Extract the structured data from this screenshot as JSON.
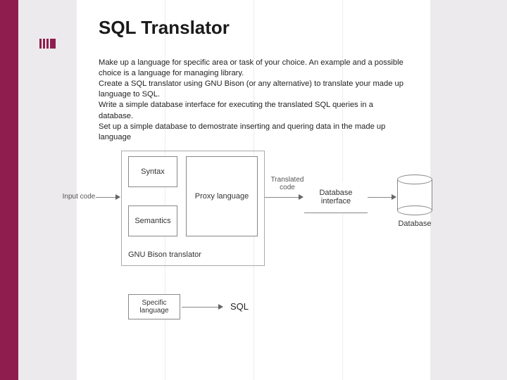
{
  "title": "SQL Translator",
  "paragraphs": [
    "Make up a language for specific area or task of your choice. An example and a possible choice is a language for managing library.",
    "Create a SQL translator using GNU Bison (or any alternative) to translate your made up language to SQL.",
    "Write a simple database interface  for executing the translated SQL queries in a database.",
    "Set up a simple database to demostrate inserting and quering data in the made up language"
  ],
  "diagram": {
    "input_label": "Input code",
    "syntax": "Syntax",
    "semantics": "Semantics",
    "proxy": "Proxy language",
    "translator_caption": "GNU Bison translator",
    "translated_label": "Translated code",
    "db_interface": "Database interface",
    "database": "Database",
    "specific_lang": "Specific language",
    "sql": "SQL"
  }
}
